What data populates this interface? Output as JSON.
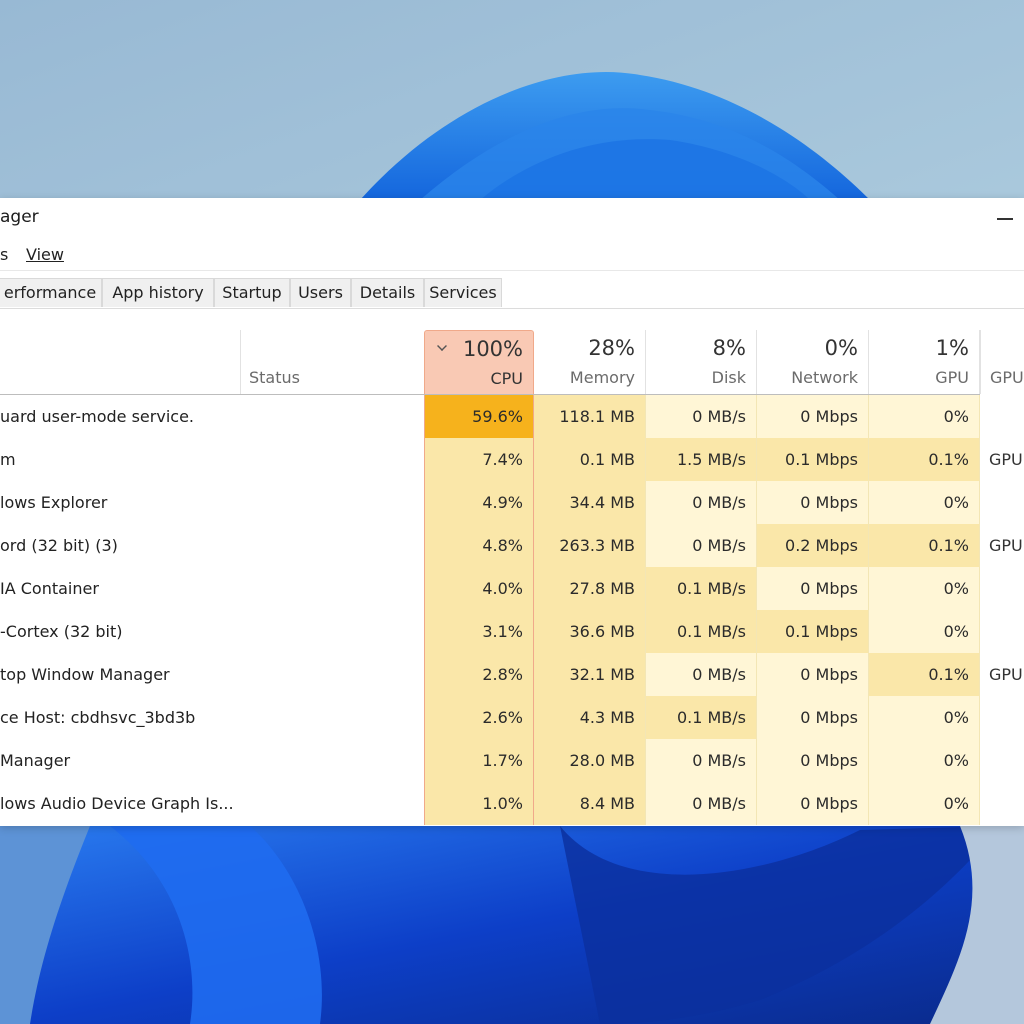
{
  "window": {
    "title": "ager",
    "menu": [
      {
        "label": "s",
        "underline_index": -1
      },
      {
        "label": "View",
        "underline_index": 0
      }
    ],
    "tabs": [
      "erformance",
      "App history",
      "Startup",
      "Users",
      "Details",
      "Services"
    ],
    "controls": {
      "minimize_icon": "minimize-icon"
    }
  },
  "table": {
    "sorted_column": "cpu",
    "sort_direction": "descending",
    "columns": {
      "status": {
        "label": "Status"
      },
      "cpu": {
        "pct": "100%",
        "label": "CPU"
      },
      "memory": {
        "pct": "28%",
        "label": "Memory"
      },
      "disk": {
        "pct": "8%",
        "label": "Disk"
      },
      "network": {
        "pct": "0%",
        "label": "Network"
      },
      "gpu": {
        "pct": "1%",
        "label": "GPU"
      },
      "gpu_engine": {
        "label": "GPU"
      }
    },
    "rows": [
      {
        "name": "uard user-mode service.",
        "cpu": "59.6%",
        "memory": "118.1 MB",
        "disk": "0 MB/s",
        "network": "0 Mbps",
        "gpu": "0%",
        "gpu_engine": ""
      },
      {
        "name": "m",
        "cpu": "7.4%",
        "memory": "0.1 MB",
        "disk": "1.5 MB/s",
        "network": "0.1 Mbps",
        "gpu": "0.1%",
        "gpu_engine": "GPU"
      },
      {
        "name": "lows Explorer",
        "cpu": "4.9%",
        "memory": "34.4 MB",
        "disk": "0 MB/s",
        "network": "0 Mbps",
        "gpu": "0%",
        "gpu_engine": ""
      },
      {
        "name": "ord (32 bit) (3)",
        "cpu": "4.8%",
        "memory": "263.3 MB",
        "disk": "0 MB/s",
        "network": "0.2 Mbps",
        "gpu": "0.1%",
        "gpu_engine": "GPU"
      },
      {
        "name": "IA Container",
        "cpu": "4.0%",
        "memory": "27.8 MB",
        "disk": "0.1 MB/s",
        "network": "0 Mbps",
        "gpu": "0%",
        "gpu_engine": ""
      },
      {
        "name": "-Cortex (32 bit)",
        "cpu": "3.1%",
        "memory": "36.6 MB",
        "disk": "0.1 MB/s",
        "network": "0.1 Mbps",
        "gpu": "0%",
        "gpu_engine": ""
      },
      {
        "name": "top Window Manager",
        "cpu": "2.8%",
        "memory": "32.1 MB",
        "disk": "0 MB/s",
        "network": "0 Mbps",
        "gpu": "0.1%",
        "gpu_engine": "GPU"
      },
      {
        "name": "ce Host: cbdhsvc_3bd3b",
        "cpu": "2.6%",
        "memory": "4.3 MB",
        "disk": "0.1 MB/s",
        "network": "0 Mbps",
        "gpu": "0%",
        "gpu_engine": ""
      },
      {
        "name": "Manager",
        "cpu": "1.7%",
        "memory": "28.0 MB",
        "disk": "0 MB/s",
        "network": "0 Mbps",
        "gpu": "0%",
        "gpu_engine": ""
      },
      {
        "name": "lows Audio Device Graph Is...",
        "cpu": "1.0%",
        "memory": "8.4 MB",
        "disk": "0 MB/s",
        "network": "0 Mbps",
        "gpu": "0%",
        "gpu_engine": ""
      }
    ]
  },
  "colors": {
    "heat_high": "#f6b21c",
    "heat_mid": "#fae7a9",
    "heat_low": "#fdf2c9",
    "heat_none": "#fff6d6",
    "sorted_header": "#f9c9b4",
    "sorted_border": "#f0a98a"
  }
}
